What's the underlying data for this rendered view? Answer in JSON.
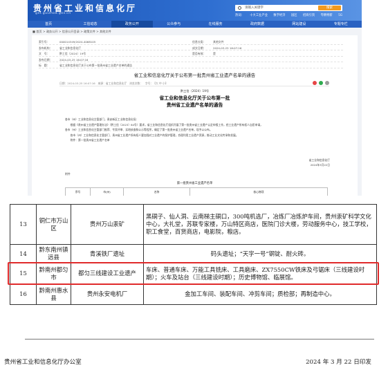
{
  "site": {
    "title": "贵州省工业和信息化厅",
    "url": "gxt.guizhou.gov.cn",
    "search_placeholder": "请输入关键字",
    "search_button": "搜索",
    "hot_words": [
      "热词：",
      "十大工业产业",
      "数字经济",
      "园区",
      "招商引资",
      "专精特新",
      "5G"
    ],
    "nav": [
      "首页",
      "工信动态",
      "政务公开",
      "公众参与",
      "在线服务",
      "政府数据",
      "网站建设",
      "专题专栏"
    ],
    "breadcrumb": "■ 首页 > 政务公开 > 信息公开目录 > 政策文件 > 其他文件",
    "meta": [
      {
        "l1": "索引号：",
        "v1": "000014349/2024-4068105",
        "l2": "信息分类：",
        "v2": "其他文件"
      },
      {
        "l1": "发布机构：",
        "v1": "省工业和信息化厅",
        "l2": "成文日期：",
        "v2": "2024-03-25 16:07:16"
      },
      {
        "l1": "文　号：",
        "v1": "黔工信（2024）19号",
        "l2": "是否有效：",
        "v2": "是"
      },
      {
        "l1": "发布日期：",
        "v1": "2024-03-25 16:07:16",
        "l2": "",
        "v2": ""
      },
      {
        "l1": "标　题：",
        "v1": "省工业和信息化厅关于公布第一批贵州省工业遗产名单的通告",
        "l2": "",
        "v2": ""
      }
    ],
    "doc_title": "省工业和信息化厅关于公布第一批贵州省工业遗产名单的通告",
    "info_left": "日期：2024-03-25 16:07:16　来源：省工业和信息化厅　浏览次数：　字号：【大 中 小】",
    "doc_num": "黔工信〔2024〕19号",
    "doc_h1": "省工业和信息化厅关于公布第一批",
    "doc_h2": "贵州省工业遗产名单的通告",
    "doc_body": [
      "各市（州）工业和信息化主管部门，贵安新区工业和信息化局：",
      "　　根据《贵州省工业遗产管理办法》（黔工信〔2023〕64号）要求，省工业和信息化厅组织开展了第一批贵州省工业遗产认定申报工作，经工业遗产所有权人自愿申请，",
      "各市（州）工业和信息化主管部门推荐、专家评审、实地核查和公示等程序，确定了第一批贵州省工业遗产名单，现予以公布。",
      "　　各市（州）工业和信息化主管部门、贵州省工业遗产所有权人要加强对工业遗产的保护管理，合理利用工业遗产资源，推动工业文化传承和发展。",
      "　　附件：第一批贵州省工业遗产名单"
    ],
    "sign_org": "省工业和信息化厅",
    "sign_date": "2024年3月22日",
    "note": "附件",
    "annex_title": "第一批贵州省工业遗产名单",
    "annex_headers": [
      "序号",
      "市(州)",
      "名称",
      "核心物项"
    ]
  },
  "table": {
    "rows": [
      {
        "no": "13",
        "loc": "铜仁市万山区",
        "name": "贵州万山汞矿",
        "core": "黑硐子、仙人洞、云南梯主硐口，300吨机选厂，冶炼厂冶炼炉车间，贵州汞矿科学文化中心，大礼堂，苏联专家楼，万山特区商店，医院门诊大楼，劳动服务中心，技工学校，职工食堂，百货商店，电影院，粮店。"
      },
      {
        "no": "14",
        "loc": "黔东南州镇远县",
        "name": "青溪铁厂遗址",
        "core": "码头遗址；“天字一号”钢锭、耐火砖。"
      },
      {
        "no": "15",
        "loc": "黔南州都匀市",
        "name": "都匀三线建设工业遗产",
        "core": "车床、普通车床、万能工具铣床、工具磨床、ZX7550CW铁床及弓锯床（三线建设时期）；火车及站台（三线建设时期）；历史博物馆、临展馆。"
      },
      {
        "no": "16",
        "loc": "黔南州惠水县",
        "name": "贵州永安电机厂",
        "core": "金加工车间、装配车间、冲剪车间；质检部；再制造中心。"
      }
    ]
  },
  "footer": {
    "left": "贵州省工业和信息化厅办公室",
    "right": "2024 年 3 月 22 日印发"
  },
  "colors": {
    "banner": "#2f6fd1",
    "highlight": "#e0292a",
    "search_button": "#f39a1e"
  }
}
